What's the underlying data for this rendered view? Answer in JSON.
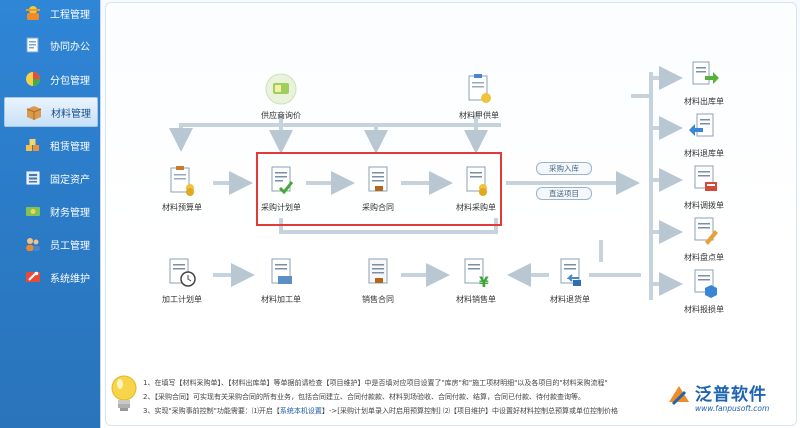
{
  "sidebar": {
    "items": [
      {
        "label": "工程管理",
        "icon": "hardhat-icon"
      },
      {
        "label": "协同办公",
        "icon": "document-icon"
      },
      {
        "label": "分包管理",
        "icon": "pie-chart-icon"
      },
      {
        "label": "材料管理",
        "icon": "box-icon"
      },
      {
        "label": "租赁管理",
        "icon": "cubes-icon"
      },
      {
        "label": "固定资产",
        "icon": "database-icon"
      },
      {
        "label": "财务管理",
        "icon": "money-icon"
      },
      {
        "label": "员工管理",
        "icon": "users-icon"
      },
      {
        "label": "系统维护",
        "icon": "tools-icon"
      }
    ],
    "active_index": 3
  },
  "flow": {
    "supplier_inquiry": "供应商询价",
    "material_supply_list": "材料甲供单",
    "material_budget": "材料预算单",
    "purchase_plan": "采购计划单",
    "purchase_contract": "采购合同",
    "material_purchase": "材料采购单",
    "tag_purchase_in": "采购入库",
    "tag_direct_project": "直送项目",
    "processing_plan": "加工计划单",
    "material_processing": "材料加工单",
    "sales_contract": "销售合同",
    "material_sales": "材料销售单",
    "material_return": "材料退货单",
    "material_out": "材料出库单",
    "material_return_stock": "材料退库单",
    "material_transfer": "材料调拨单",
    "material_inventory": "材料盘点单",
    "material_loss": "材料报损单"
  },
  "tips": {
    "line1": "1、在填写【材料采购单】、【材料出库单】等单据前请检查【项目维护】中是否填对应项目设置了\"库房\"和\"施工项材明细\"以及各项目的\"材料采购流程\"",
    "line2": "2、【采购合同】可实现有关采购合同的所有业务，包括合同建立、合同付款款、材料到场验收、合同付款、结算，合同已付款、待付款查询等。",
    "line3_a": "3、实现\"采购事前控制\"功能需要：⑴开启【",
    "line3_link": "系统本机设置",
    "line3_b": "】->[采购计划单录入时启用预算控制] ⑵【项目维护】中设置好材料控制总预算或单位控制价格"
  },
  "brand": {
    "name": "泛普软件",
    "url": "www.fanpusoft.com"
  },
  "colors": {
    "sidebar_bg": "#2b7cc8",
    "highlight": "#e03a3a",
    "brand": "#1e64b0"
  }
}
